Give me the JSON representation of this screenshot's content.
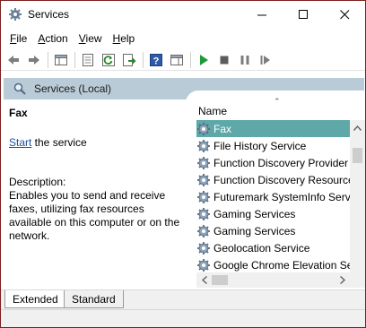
{
  "window": {
    "title": "Services",
    "icon": "gear-icon"
  },
  "menu": [
    {
      "label": "File",
      "accel": "F",
      "rest": "ile"
    },
    {
      "label": "Action",
      "accel": "A",
      "rest": "ction"
    },
    {
      "label": "View",
      "accel": "V",
      "rest": "iew"
    },
    {
      "label": "Help",
      "accel": "H",
      "rest": "elp"
    }
  ],
  "toolbar": {
    "icons": [
      "back-arrow-icon",
      "forward-arrow-icon",
      "show-hide-console-tree-icon",
      "properties-icon",
      "refresh-icon",
      "export-list-icon",
      "help-icon",
      "show-hide-action-pane-icon",
      "start-service-icon",
      "stop-service-icon",
      "pause-service-icon",
      "restart-service-icon"
    ]
  },
  "scope": {
    "title": "Services (Local)"
  },
  "detail": {
    "service_name": "Fax",
    "start_link": "Start",
    "start_rest": " the service",
    "description_label": "Description:",
    "description": "Enables you to send and receive faxes, utilizing fax resources available on this computer or on the network."
  },
  "list": {
    "column_header": "Name",
    "rows": [
      {
        "name": "Fax",
        "selected": true
      },
      {
        "name": "File History Service",
        "selected": false
      },
      {
        "name": "Function Discovery Provider",
        "selected": false
      },
      {
        "name": "Function Discovery Resource",
        "selected": false
      },
      {
        "name": "Futuremark SystemInfo Servi",
        "selected": false
      },
      {
        "name": "Gaming Services",
        "selected": false
      },
      {
        "name": "Gaming Services",
        "selected": false
      },
      {
        "name": "Geolocation Service",
        "selected": false
      },
      {
        "name": "Google Chrome Elevation Se",
        "selected": false
      }
    ]
  },
  "tabs": [
    {
      "label": "Extended",
      "active": true
    },
    {
      "label": "Standard",
      "active": false
    }
  ],
  "colors": {
    "accent_border": "#7a1f1f",
    "scope_header": "#b9cbd6",
    "selection": "#5fa8a8",
    "link": "#1a4f9e"
  }
}
